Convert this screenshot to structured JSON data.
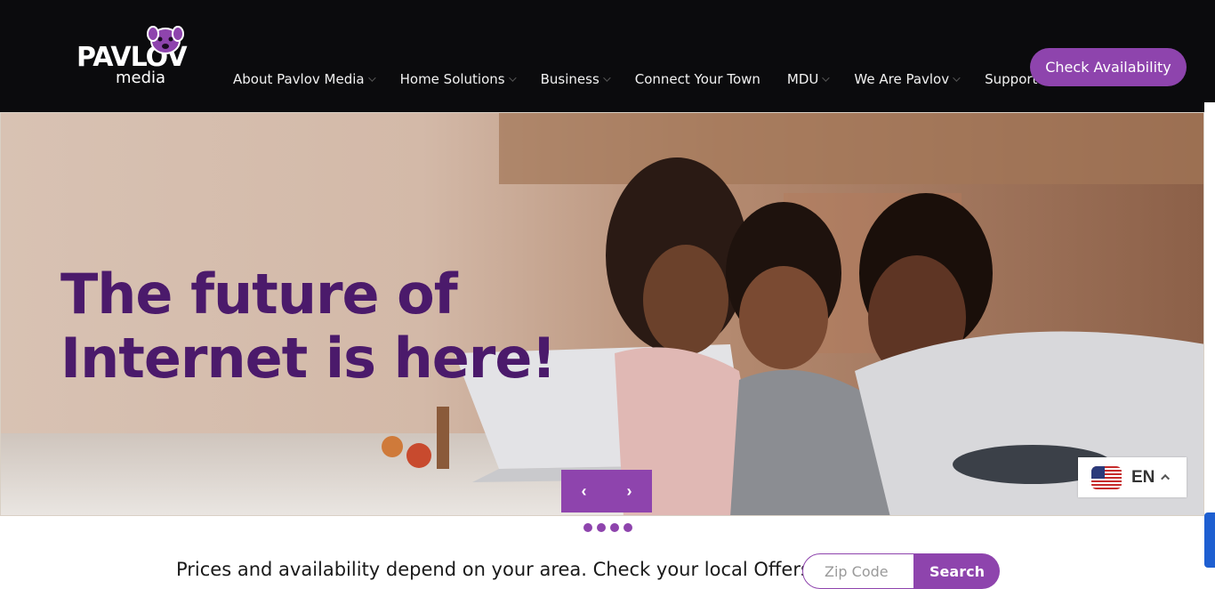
{
  "brand": {
    "logo_word": "PAVLOV",
    "logo_sub": "media"
  },
  "nav": {
    "items": [
      {
        "label": "About Pavlov Media",
        "has_dropdown": true
      },
      {
        "label": "Home Solutions",
        "has_dropdown": true
      },
      {
        "label": "Business",
        "has_dropdown": true
      },
      {
        "label": "Connect Your Town",
        "has_dropdown": false
      },
      {
        "label": "MDU",
        "has_dropdown": true
      },
      {
        "label": "We Are Pavlov",
        "has_dropdown": true
      },
      {
        "label": "Support",
        "has_dropdown": false
      }
    ]
  },
  "cta": {
    "label": "Check Availability"
  },
  "hero": {
    "title_line1": "The future of",
    "title_line2": "Internet is here!",
    "prev_label": "‹",
    "next_label": "›",
    "dots_count": 4
  },
  "language": {
    "code": "EN",
    "flag": "us-flag-icon"
  },
  "offers": {
    "text": "Prices and availability depend on your area. Check your local Offers.",
    "zip_placeholder": "Zip Code",
    "search_label": "Search"
  },
  "colors": {
    "header_bg": "#0b0b0d",
    "accent": "#8e44ad",
    "hero_title": "#4b1a6b"
  }
}
